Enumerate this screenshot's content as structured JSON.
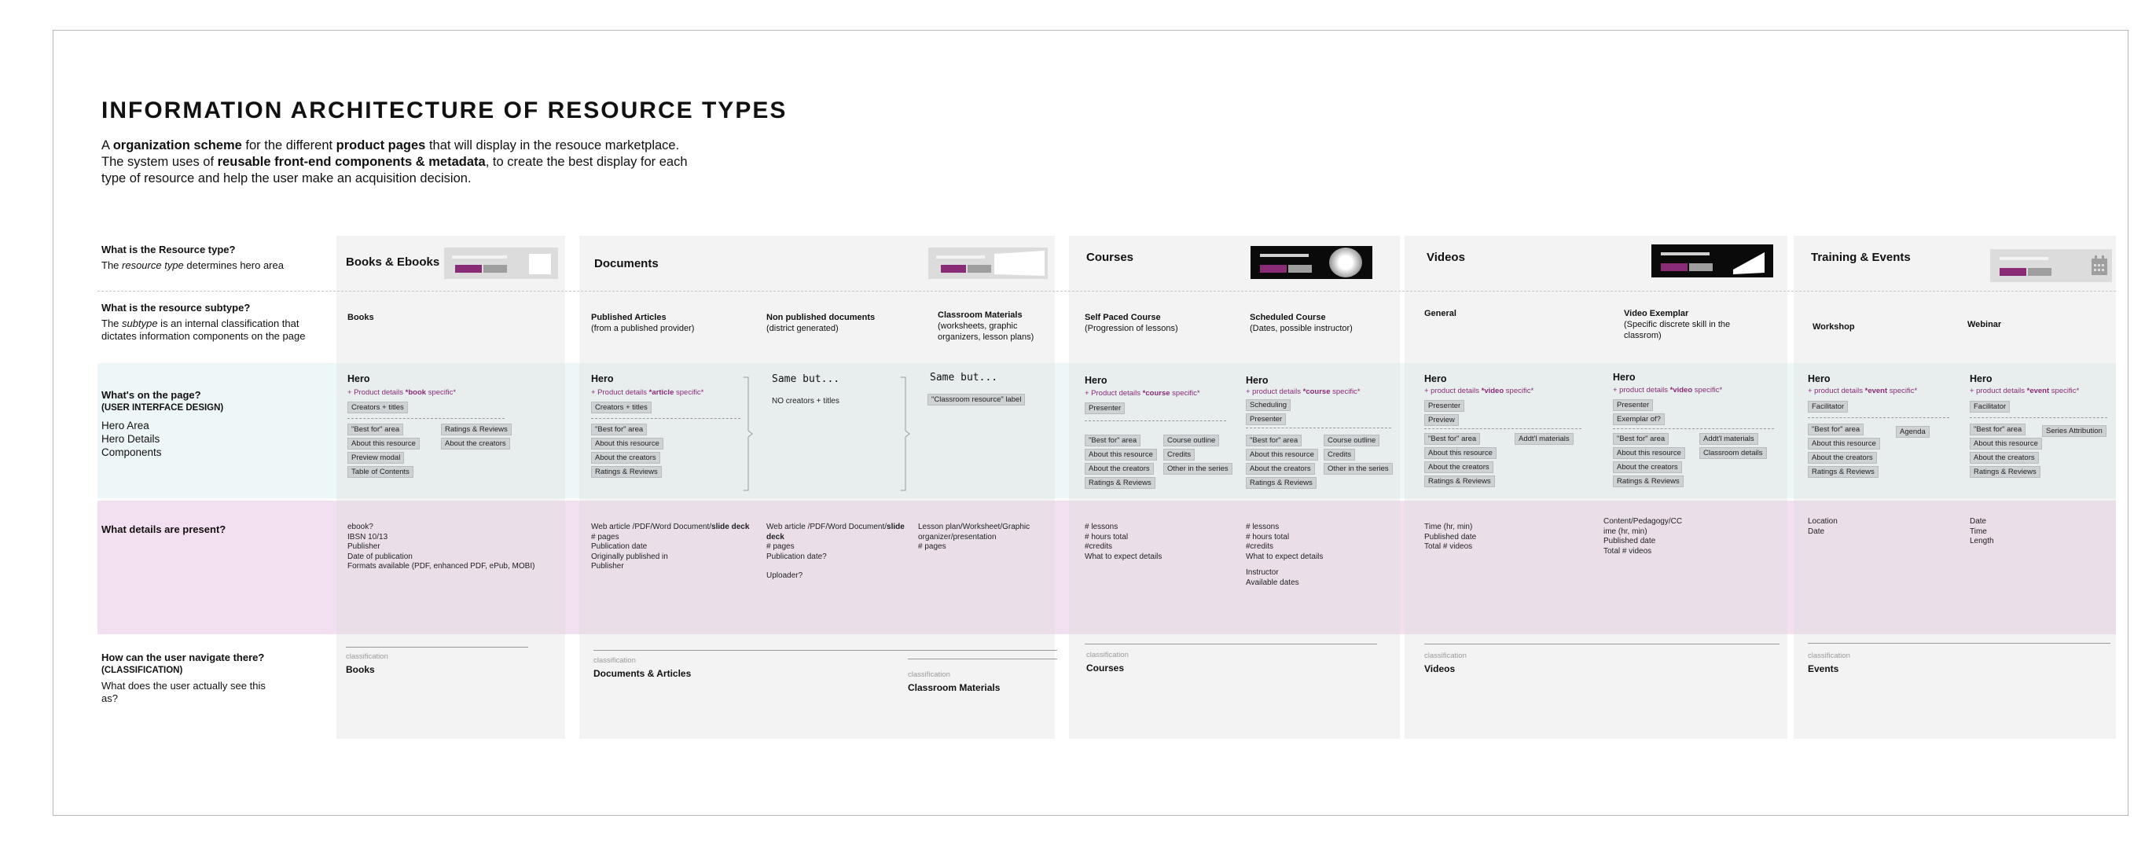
{
  "title": "INFORMATION ARCHITECTURE OF RESOURCE TYPES",
  "intro": {
    "l1a": "A ",
    "l1b": "organization scheme",
    "l1c": " for the different ",
    "l1d": "product pages",
    "l1e": " that will display in the resouce marketplace.",
    "l2a": "The system uses of ",
    "l2b": "reusable front-end components & metadata",
    "l2c": ", to create the best display for each",
    "l3": "type of resource and help the user make an acquisition decision."
  },
  "questions": {
    "type": {
      "title": "What is the Resource type?",
      "desc_a": "The ",
      "desc_em": "resource type",
      "desc_b": " determines hero area"
    },
    "subtype": {
      "title": "What is the resource subtype?",
      "desc_a": "The ",
      "desc_em": "subtype",
      "desc_b": " is an internal classification that",
      "desc_c": "dictates information components on the page"
    },
    "page": {
      "title": "What's on the page?",
      "sub": "(USER INTERFACE DESIGN)",
      "items": [
        "Hero Area",
        "Hero Details",
        "Components"
      ]
    },
    "details": {
      "title": "What details are present?"
    },
    "navigate": {
      "title": "How can the user navigate there?",
      "sub": "(CLASSIFICATION)",
      "desc_a": "What does the user actually see this",
      "desc_b": "as?"
    }
  },
  "columns": {
    "books": {
      "name": "Books & Ebooks",
      "subtype": "Books",
      "hero": "Hero",
      "pd_a": "+ Product details  ",
      "pd_b": "*book",
      "pd_c": " specific*",
      "chip1": "Creators + titles",
      "left": [
        "\"Best for\" area",
        "About this resource",
        "Preview modal",
        "Table of Contents"
      ],
      "right": [
        "Ratings & Reviews",
        "About the creators"
      ],
      "details": [
        "ebook?",
        "IBSN 10/13",
        "Publisher",
        "Date of publication",
        "Formats available (PDF, enhanced PDF, ePub, MOBI)"
      ],
      "cls": "classification",
      "nav": "Books"
    },
    "documents": {
      "name": "Documents",
      "sub1": {
        "name": "Published Articles",
        "desc": "(from a published provider)"
      },
      "sub2": {
        "name": "Non published documents",
        "desc": "(district generated)"
      },
      "sub3": {
        "name": "Classroom Materials",
        "desc1": "(worksheets, graphic",
        "desc2": "organizers, lesson plans)"
      },
      "hero": "Hero",
      "pd_a": "+ Product details  ",
      "pd_b": "*article",
      "pd_c": " specific*",
      "chip1": "Creators + titles",
      "list": [
        "\"Best for\" area",
        "About this resource",
        "About the creators",
        "Ratings & Reviews"
      ],
      "same1": "Same but...",
      "same1_note": "NO creators + titles",
      "same2": "Same but...",
      "same2_chip": "\"Classroom resource\" label",
      "det1": [
        "Web article /PDF/Word Document/",
        "slide deck",
        "# pages",
        "Publication date",
        "Originally published in",
        "Publisher"
      ],
      "det2": [
        "Web article /PDF/Word Document/",
        "slide",
        "deck",
        "# pages",
        "Publication date?",
        "",
        "Uploader?"
      ],
      "det3": [
        "Lesson plan/Worksheet/Graphic",
        "organizer/presentation",
        "# pages"
      ],
      "cls1": "classification",
      "nav1": "Documents & Articles",
      "cls2": "classification",
      "nav2": "Classroom Materials"
    },
    "courses": {
      "name": "Courses",
      "sub1": {
        "name": "Self Paced Course",
        "desc": "(Progression of lessons)"
      },
      "sub2": {
        "name": "Scheduled  Course",
        "desc": "(Dates, possible instructor)"
      },
      "hero1": "Hero",
      "pd1_a": "+ Product details  ",
      "pd1_b": "*course",
      "pd1_c": " specific*",
      "h1chips": [
        "Presenter"
      ],
      "l1": [
        "\"Best for\" area",
        "About this resource",
        "About the creators",
        "Ratings & Reviews"
      ],
      "r1": [
        "Course outline",
        "Credits",
        "Other in the series"
      ],
      "hero2": "Hero",
      "pd2_a": "+ product details ",
      "pd2_b": "*course",
      "pd2_c": " specific*",
      "h2chips": [
        "Scheduling",
        "Presenter"
      ],
      "l2": [
        "\"Best for\" area",
        "About this resource",
        "About the creators",
        "Ratings & Reviews"
      ],
      "r2": [
        "Course outline",
        "Credits",
        "Other in the series"
      ],
      "det1": [
        "# lessons",
        "# hours total",
        "#credits",
        "What to expect details"
      ],
      "det2": [
        "# lessons",
        "# hours total",
        "#credits",
        "What to expect details",
        "",
        "Instructor",
        "Available dates"
      ],
      "cls": "classification",
      "nav": "Courses"
    },
    "videos": {
      "name": "Videos",
      "sub1": {
        "name": "General"
      },
      "sub2": {
        "name": "Video Exemplar",
        "desc1": "(Specific discrete skill in the",
        "desc2": "classrom)"
      },
      "hero1": "Hero",
      "pd1_a": "+ product details ",
      "pd1_b": "*video",
      "pd1_c": " specific*",
      "h1chips": [
        "Presenter",
        "Preview"
      ],
      "l1": [
        "\"Best for\" area",
        "About this resource",
        "About the creators",
        "Ratings & Reviews"
      ],
      "r1": [
        "Addt'l materials"
      ],
      "hero2": "Hero",
      "pd2_a": "+ product details ",
      "pd2_b": "*video",
      "pd2_c": " specific*",
      "h2chips": [
        "Presenter",
        "Exemplar of?"
      ],
      "l2": [
        "\"Best for\" area",
        "About this resource",
        "About the creators",
        "Ratings & Reviews"
      ],
      "r2": [
        "Addt'l materials",
        "Classroom details"
      ],
      "det1": [
        "Time (hr, min)",
        "Published date",
        "Total # videos"
      ],
      "det2": [
        "Content/Pedagogy/CC",
        "ime (hr, min)",
        "Published date",
        "Total # videos"
      ],
      "cls": "classification",
      "nav": "Videos"
    },
    "events": {
      "name": "Training & Events",
      "sub1": {
        "name": "Workshop"
      },
      "sub2": {
        "name": "Webinar"
      },
      "hero1": "Hero",
      "pd1_a": "+ product details ",
      "pd1_b": "*event",
      "pd1_c": " specific*",
      "h1chips": [
        "Facilitator"
      ],
      "l1": [
        "\"Best for\" area",
        "About this resource",
        "About the creators",
        "Ratings & Reviews"
      ],
      "r1": [
        "Agenda"
      ],
      "hero2": "Hero",
      "pd2_a": "+ product details ",
      "pd2_b": "*event",
      "pd2_c": " specific*",
      "h2chips": [
        "Facilitator"
      ],
      "l2": [
        "\"Best for\" area",
        "About this resource",
        "About the creators",
        "Ratings & Reviews"
      ],
      "r2": [
        "Series Attribution"
      ],
      "det1": [
        "Location",
        "Date"
      ],
      "det2": [
        "Date",
        "Time",
        "Length"
      ],
      "cls": "classification",
      "nav": "Events"
    }
  },
  "colors": {
    "accent": "#8a2b78",
    "chip": "#cfd2d4",
    "teal_band": "#eef7f8",
    "pink_band": "#f2e0f0"
  }
}
